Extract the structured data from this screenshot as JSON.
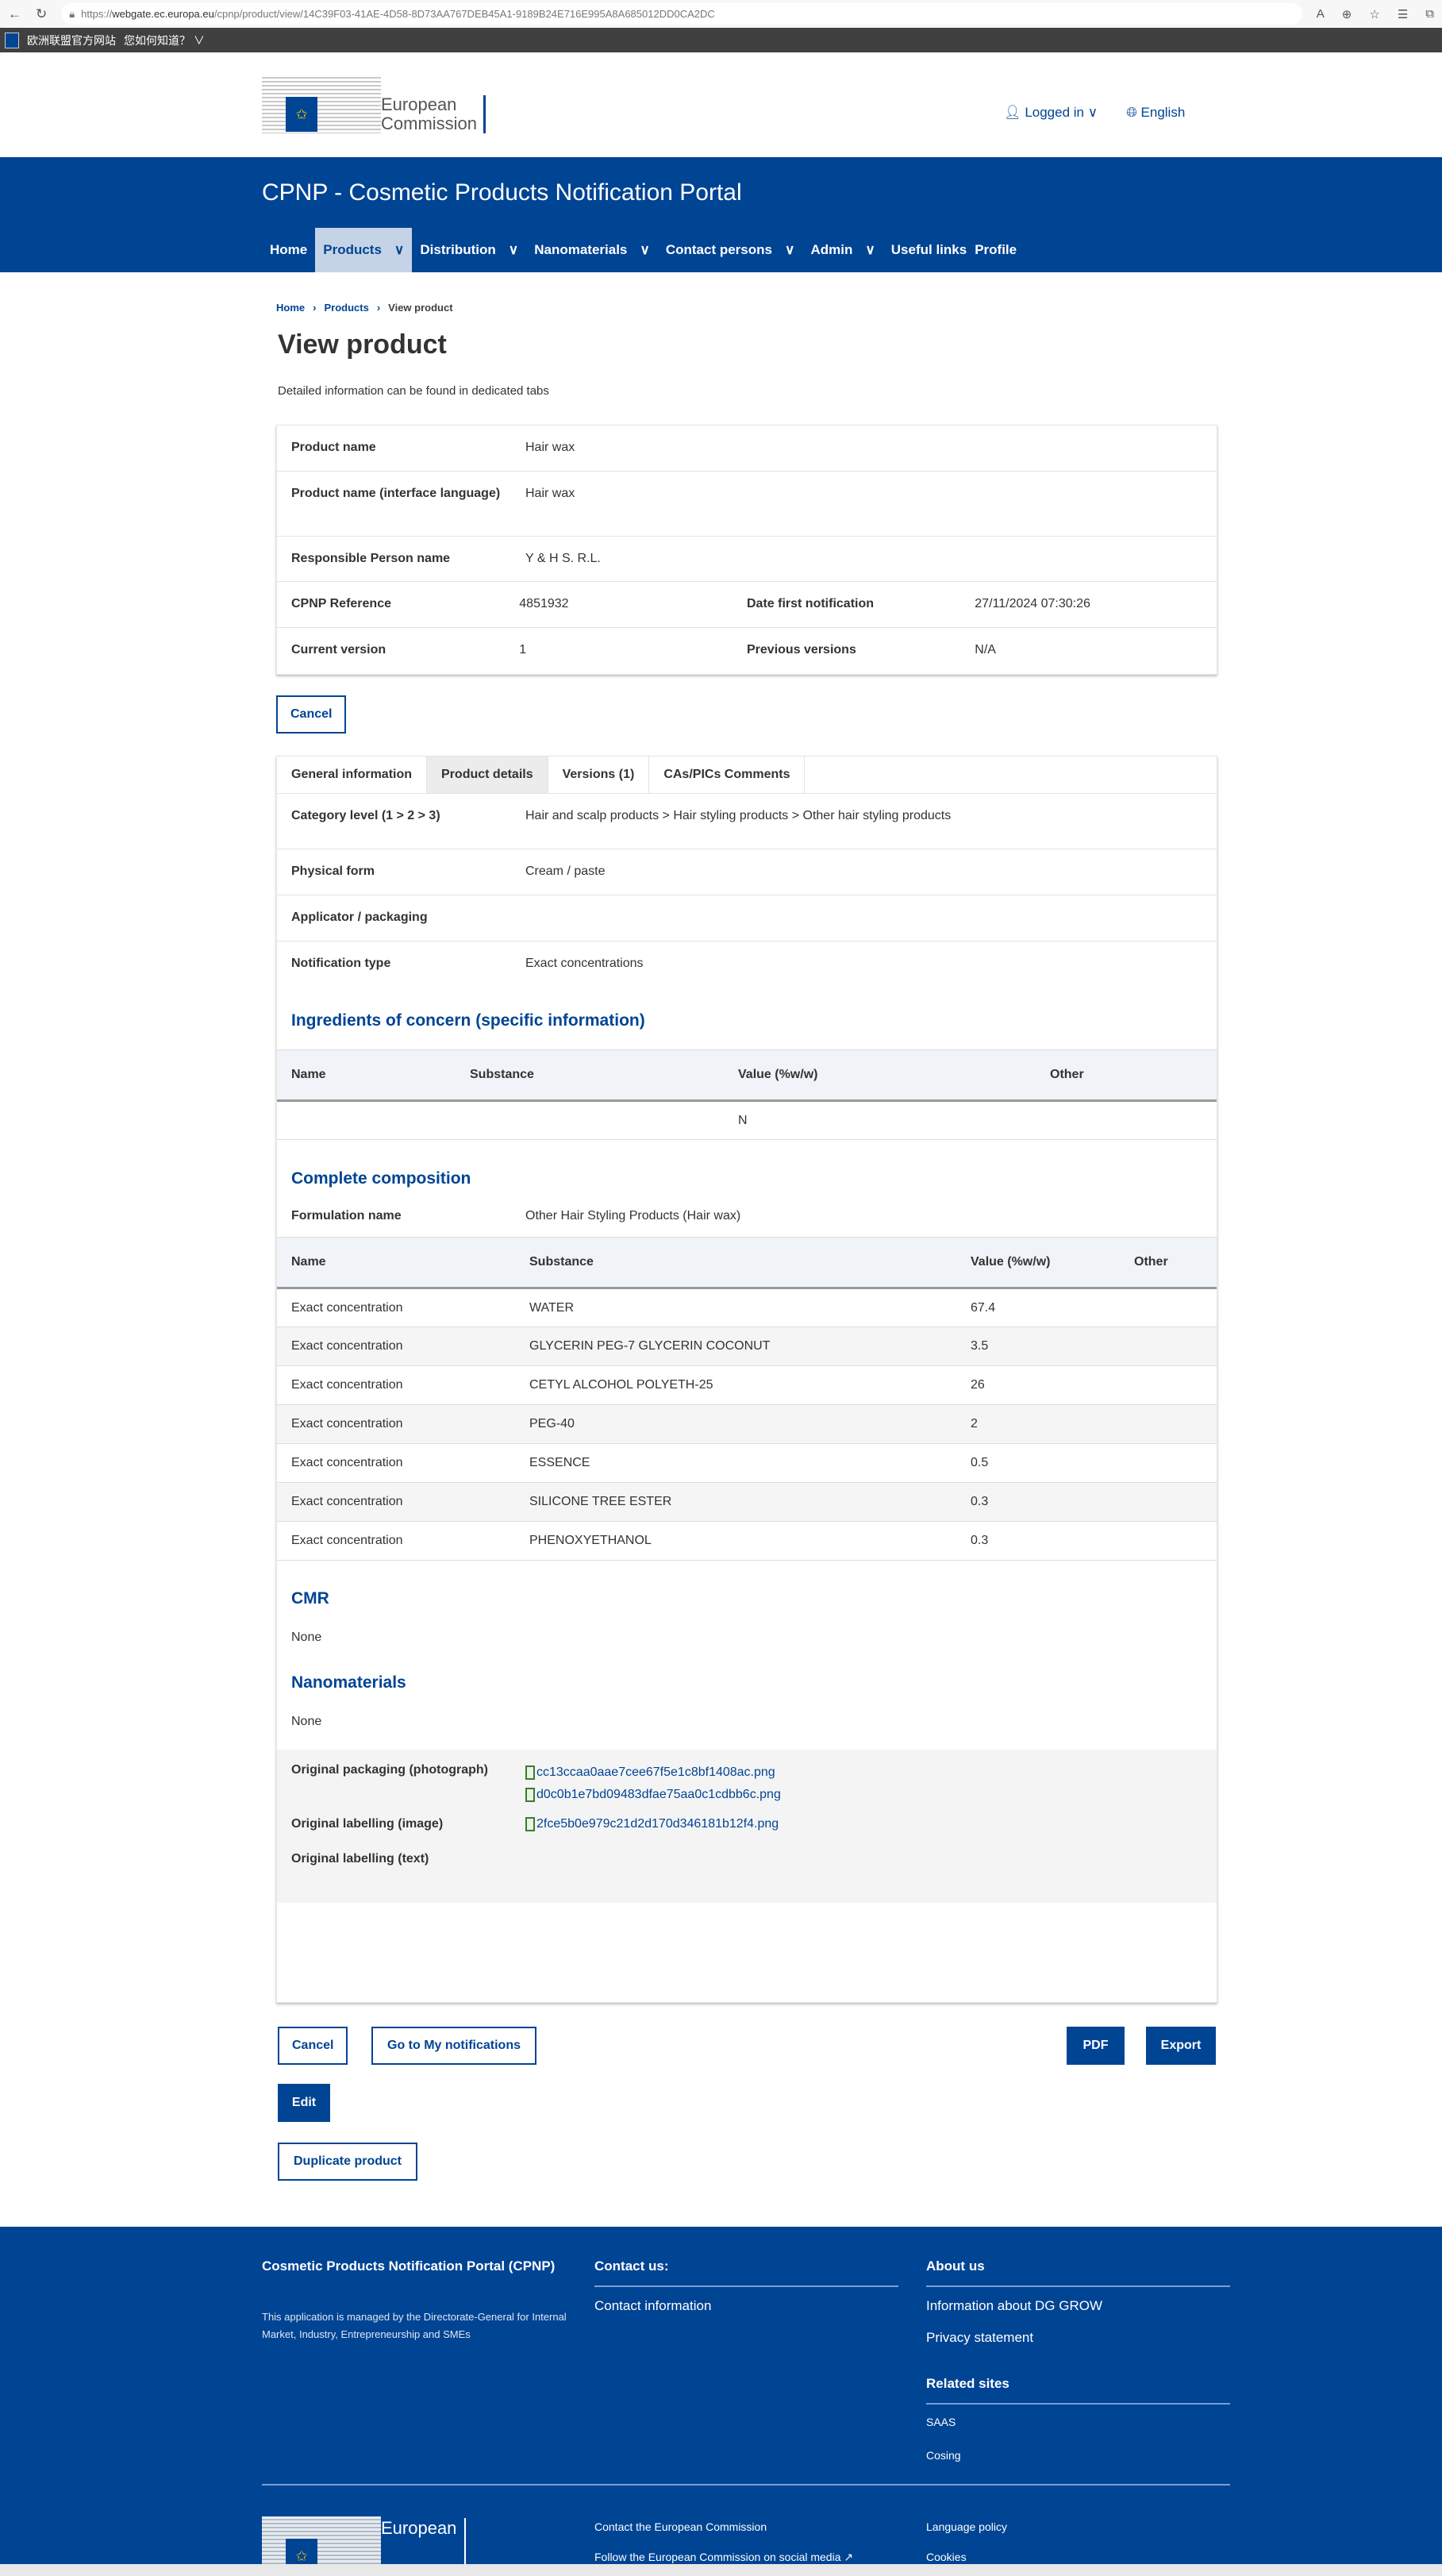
{
  "browser": {
    "url_prefix": "https://",
    "url_host": "webgate.ec.europa.eu",
    "url_path": "/cpnp/product/view/14C39F03-41AE-4D58-8D73AA767DEB45A1-9189B24E716E995A8A685012DD0CA2DC"
  },
  "eu_bar": {
    "site_label": "欧洲联盟官方网站",
    "how_to_know": "您如何知道？"
  },
  "header": {
    "logo_line1": "European",
    "logo_line2": "Commission",
    "logged_in": "Logged in",
    "language": "English"
  },
  "band": {
    "title": "CPNP - Cosmetic Products Notification Portal"
  },
  "nav": [
    "Home",
    "Products",
    "Distribution",
    "Nanomaterials",
    "Contact persons",
    "Admin",
    "Useful links",
    "Profile"
  ],
  "breadcrumb": [
    "Home",
    "Products",
    "View product"
  ],
  "page": {
    "title": "View product",
    "description": "Detailed information can be found in dedicated tabs"
  },
  "summary": {
    "product_name_label": "Product name",
    "product_name": "Hair wax",
    "product_name_if_label": "Product name (interface language)",
    "product_name_if": "Hair wax",
    "rp_label": "Responsible Person name",
    "rp": "Y & H S. R.L.",
    "ref_label": "CPNP Reference",
    "ref": "4851932",
    "date_label": "Date first notification",
    "date": "27/11/2024 07:30:26",
    "version_label": "Current version",
    "version": "1",
    "prev_label": "Previous versions",
    "prev": "N/A"
  },
  "buttons": {
    "cancel": "Cancel",
    "go_notifications": "Go to My notifications",
    "pdf": "PDF",
    "export": "Export",
    "edit": "Edit",
    "duplicate": "Duplicate product"
  },
  "tabs": [
    "General information",
    "Product details",
    "Versions (1)",
    "CAs/PICs Comments"
  ],
  "details": {
    "category_label": "Category level (1 > 2 > 3)",
    "category": "Hair and scalp products > Hair styling products > Other hair styling products",
    "form_label": "Physical form",
    "form": "Cream / paste",
    "applicator_label": "Applicator / packaging",
    "notif_label": "Notification type",
    "notif": "Exact concentrations"
  },
  "ingredients": {
    "title": "Ingredients of concern (specific information)",
    "headers": [
      "Name",
      "Substance",
      "Value (%w/w)",
      "Other"
    ],
    "row_value": "N"
  },
  "composition": {
    "title": "Complete composition",
    "formulation_label": "Formulation name",
    "formulation": "Other Hair Styling Products (Hair wax)",
    "headers": [
      "Name",
      "Substance",
      "Value (%w/w)",
      "Other"
    ],
    "rows": [
      {
        "name": "Exact concentration",
        "substance": "WATER",
        "value": "67.4"
      },
      {
        "name": "Exact concentration",
        "substance": "GLYCERIN PEG-7 GLYCERIN COCONUT",
        "value": "3.5"
      },
      {
        "name": "Exact concentration",
        "substance": "CETYL ALCOHOL POLYETH-25",
        "value": "26"
      },
      {
        "name": "Exact concentration",
        "substance": "PEG-40",
        "value": "2"
      },
      {
        "name": "Exact concentration",
        "substance": "ESSENCE",
        "value": "0.5"
      },
      {
        "name": "Exact concentration",
        "substance": "SILICONE TREE ESTER",
        "value": "0.3"
      },
      {
        "name": "Exact concentration",
        "substance": "PHENOXYETHANOL",
        "value": "0.3"
      }
    ]
  },
  "cmr": {
    "title": "CMR",
    "value": "None"
  },
  "nano": {
    "title": "Nanomaterials",
    "value": "None"
  },
  "files": {
    "packaging_label": "Original packaging (photograph)",
    "packaging": [
      "cc13ccaa0aae7cee67f5e1c8bf1408ac.png",
      "d0c0b1e7bd09483dfae75aa0c1cdbb6c.png"
    ],
    "labelling_img_label": "Original labelling (image)",
    "labelling_img": "2fce5b0e979c21d2d170d346181b12f4.png",
    "labelling_txt_label": "Original labelling (text)"
  },
  "footer": {
    "portal_title": "Cosmetic Products Notification Portal (CPNP)",
    "managed": "This application is managed by the Directorate-General for Internal Market, Industry, Entrepreneurship and SMEs",
    "contact_title": "Contact us:",
    "contact_info": "Contact information",
    "about_title": "About us",
    "about_links": [
      "Information about DG GROW",
      "Privacy statement"
    ],
    "related_title": "Related sites",
    "related_links": [
      "SAAS",
      "Cosing"
    ],
    "bottom_mid": [
      "Contact the European Commission",
      "Follow the European Commission on social media"
    ],
    "bottom_right": [
      "Language policy",
      "Cookies"
    ]
  }
}
